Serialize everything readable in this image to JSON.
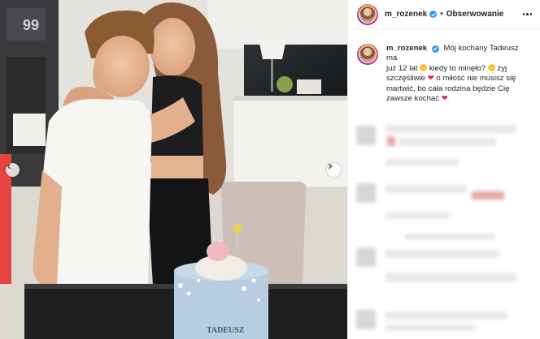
{
  "post": {
    "username": "m_rozenek",
    "follow_label": "Obserwowanie",
    "separator": "•",
    "caption": {
      "line1": "Mój kochany Tadeusz ma",
      "line2a": "już 12 lat",
      "line2b": "kiedy to minęło?",
      "line2c": "żyj",
      "line3a": "szczęśliwie",
      "line3b": "o miłość nie musisz się",
      "line4": "martwić, bo cała rodzina będzie Cię",
      "line5": "zawsze kochać"
    }
  },
  "photo": {
    "cake_text": "TADEUSZ",
    "jersey_number": "99"
  },
  "colors": {
    "verified_blue": "#3897f0",
    "heart_red": "#e0245e",
    "text": "#262626",
    "border": "#efefef"
  },
  "icons": [
    "verified-badge-icon",
    "more-options-icon",
    "chevron-left-icon",
    "chevron-right-icon",
    "heart-emoji-icon",
    "grin-emoji-icon"
  ]
}
